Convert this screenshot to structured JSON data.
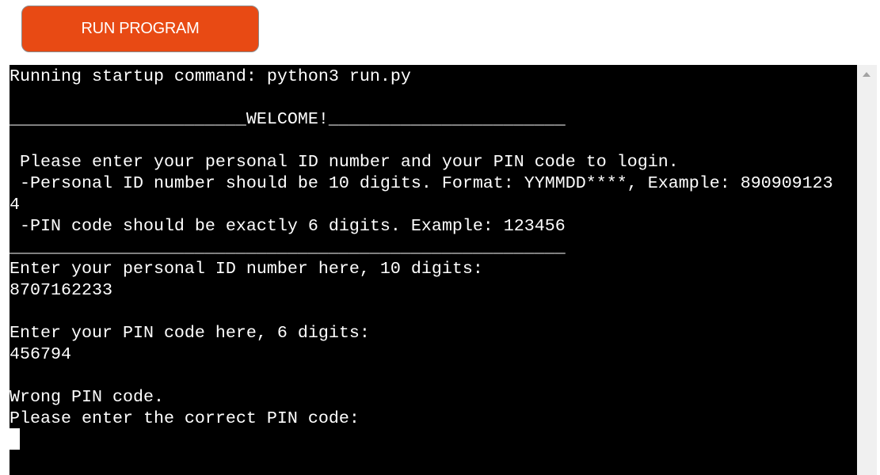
{
  "toolbar": {
    "run_label": "RUN PROGRAM"
  },
  "terminal": {
    "lines": [
      "Running startup command: python3 run.py",
      "",
      "_______________________WELCOME!_______________________",
      "",
      " Please enter your personal ID number and your PIN code to login.",
      " -Personal ID number should be 10 digits. Format: YYMMDD****, Example: 890909123",
      "4",
      " -PIN code should be exactly 6 digits. Example: 123456",
      "______________________________________________________",
      "Enter your personal ID number here, 10 digits:",
      "8707162233",
      "",
      "Enter your PIN code here, 6 digits:",
      "456794",
      "",
      "Wrong PIN code.",
      "Please enter the correct PIN code:"
    ]
  }
}
